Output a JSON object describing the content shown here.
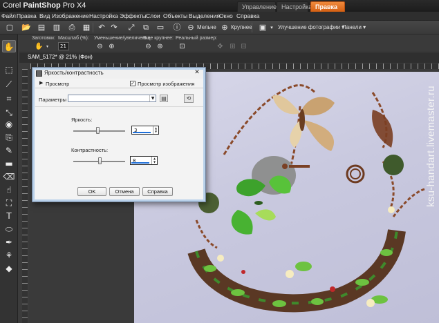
{
  "app": {
    "brand_prefix": "Corel ",
    "brand_bold": "PaintShop",
    "brand_suffix": " Pro X4"
  },
  "workspace_tabs": [
    {
      "label": "Управление"
    },
    {
      "label": "Настройка"
    },
    {
      "label": "Правка",
      "active": true
    }
  ],
  "menu": [
    "Файл",
    "Правка",
    "Вид",
    "Изображение",
    "Настройка",
    "Эффекты",
    "Слои",
    "Объекты",
    "Выделения",
    "Окно",
    "Справка"
  ],
  "toolbar": {
    "smaller_label": "Мельче",
    "larger_label": "Крупнее",
    "enhance_label": "Улучшение фотографии",
    "panels_label": "Панели"
  },
  "tool_options": {
    "preset_label": "Заготовки:",
    "scale_label": "Масштаб (%):",
    "zoom_value": "21",
    "zoom_inout_label": "Уменьшение/увеличение:",
    "zoom_more_label": "Еще крупнее:",
    "actual_size_label": "Реальный размер:"
  },
  "document": {
    "tab_title": "SAM_5172* @  21% (Фон)"
  },
  "dialog": {
    "title": "Яркость/контрастность",
    "preview_label": "Просмотр",
    "preview_image_label": "Просмотр изображения",
    "preview_image_checked": true,
    "params_label": "Параметры",
    "params_value": "",
    "brightness_label": "Яркость:",
    "brightness_value": "3",
    "contrast_label": "Контрастность:",
    "contrast_value": "8",
    "ok_label": "OK",
    "cancel_label": "Отмена",
    "help_label": "Справка"
  },
  "watermark": "ksu-handart.livemaster.ru",
  "colors": {
    "active_tab": "#e06a1c",
    "photo_bg": "#c9c9df"
  }
}
